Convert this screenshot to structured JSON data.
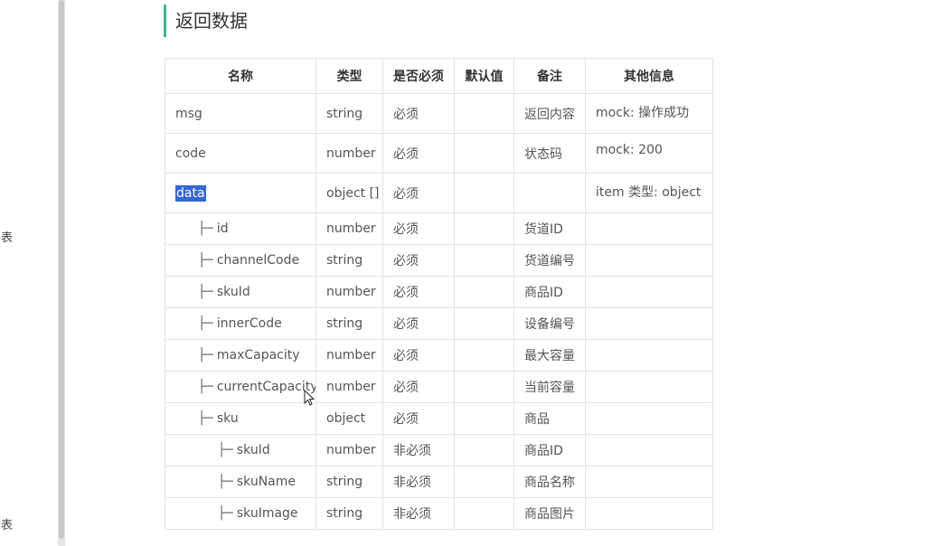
{
  "sidebar": {
    "item_1": "列表",
    "item_2": "列表"
  },
  "section": {
    "title": "返回数据"
  },
  "table": {
    "headers": [
      "名称",
      "类型",
      "是否必须",
      "默认值",
      "备注",
      "其他信息"
    ],
    "tree_prefix": "├─",
    "rows": [
      {
        "name": "msg",
        "type": "string",
        "required": "必须",
        "default": "",
        "note": "返回内容",
        "other": "mock: 操作成功"
      },
      {
        "name": "code",
        "type": "number",
        "required": "必须",
        "default": "",
        "note": "状态码",
        "other": "mock: 200"
      },
      {
        "name": "data",
        "type": "object []",
        "required": "必须",
        "default": "",
        "note": "",
        "other": "item 类型: object"
      },
      {
        "name": "id",
        "type": "number",
        "required": "必须",
        "default": "",
        "note": "货道ID",
        "other": ""
      },
      {
        "name": "channelCode",
        "type": "string",
        "required": "必须",
        "default": "",
        "note": "货道编号",
        "other": ""
      },
      {
        "name": "skuId",
        "type": "number",
        "required": "必须",
        "default": "",
        "note": "商品ID",
        "other": ""
      },
      {
        "name": "innerCode",
        "type": "string",
        "required": "必须",
        "default": "",
        "note": "设备编号",
        "other": ""
      },
      {
        "name": "maxCapacity",
        "type": "number",
        "required": "必须",
        "default": "",
        "note": "最大容量",
        "other": ""
      },
      {
        "name": "currentCapacity",
        "type": "number",
        "required": "必须",
        "default": "",
        "note": "当前容量",
        "other": ""
      },
      {
        "name": "sku",
        "type": "object",
        "required": "必须",
        "default": "",
        "note": "商品",
        "other": ""
      },
      {
        "name": "skuId",
        "type": "number",
        "required": "非必须",
        "default": "",
        "note": "商品ID",
        "other": ""
      },
      {
        "name": "skuName",
        "type": "string",
        "required": "非必须",
        "default": "",
        "note": "商品名称",
        "other": ""
      },
      {
        "name": "skuImage",
        "type": "string",
        "required": "非必须",
        "default": "",
        "note": "商品图片",
        "other": ""
      }
    ]
  },
  "colors": {
    "accent": "#42b983",
    "selection": "#3367d6",
    "border": "#e2e2e2"
  }
}
